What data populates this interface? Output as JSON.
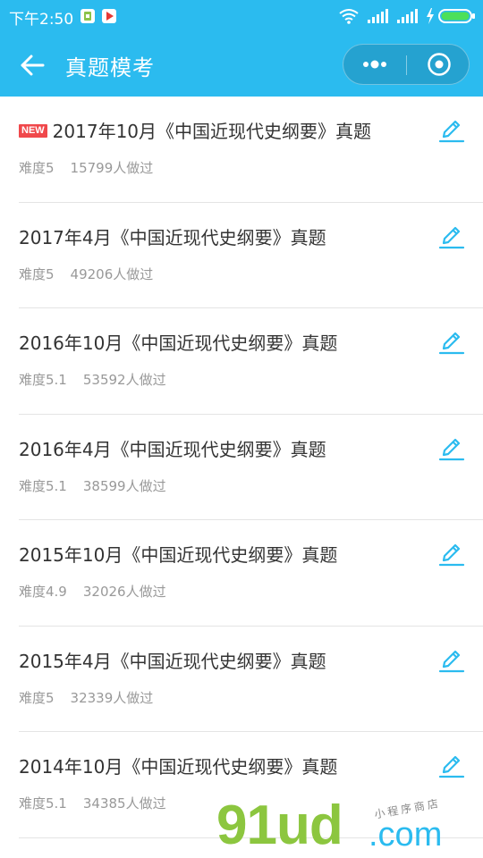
{
  "status_bar": {
    "time": "下午2:50",
    "icons": [
      "sim-card-icon",
      "play-store-icon",
      "wifi-icon",
      "signal-icon",
      "signal-icon",
      "charging-icon",
      "battery-icon"
    ]
  },
  "nav": {
    "title": "真题模考",
    "back_icon": "arrow-left-icon",
    "more_icon": "more-dots-icon",
    "close_icon": "target-close-icon"
  },
  "colors": {
    "header": "#2BBBEF",
    "badge": "#F0484B",
    "edit_icon": "#2BBBEF"
  },
  "new_badge": "NEW",
  "items": [
    {
      "title": "2017年10月《中国近现代史纲要》真题",
      "difficulty": "难度5",
      "count": "15799人做过",
      "is_new": true
    },
    {
      "title": "2017年4月《中国近现代史纲要》真题",
      "difficulty": "难度5",
      "count": "49206人做过",
      "is_new": false
    },
    {
      "title": "2016年10月《中国近现代史纲要》真题",
      "difficulty": "难度5.1",
      "count": "53592人做过",
      "is_new": false
    },
    {
      "title": "2016年4月《中国近现代史纲要》真题",
      "difficulty": "难度5.1",
      "count": "38599人做过",
      "is_new": false
    },
    {
      "title": "2015年10月《中国近现代史纲要》真题",
      "difficulty": "难度4.9",
      "count": "32026人做过",
      "is_new": false
    },
    {
      "title": "2015年4月《中国近现代史纲要》真题",
      "difficulty": "难度5",
      "count": "32339人做过",
      "is_new": false
    },
    {
      "title": "2014年10月《中国近现代史纲要》真题",
      "difficulty": "难度5.1",
      "count": "34385人做过",
      "is_new": false
    }
  ],
  "watermark": {
    "logo": "91ud",
    "domain": ".com",
    "tagline": "小程序商店"
  }
}
